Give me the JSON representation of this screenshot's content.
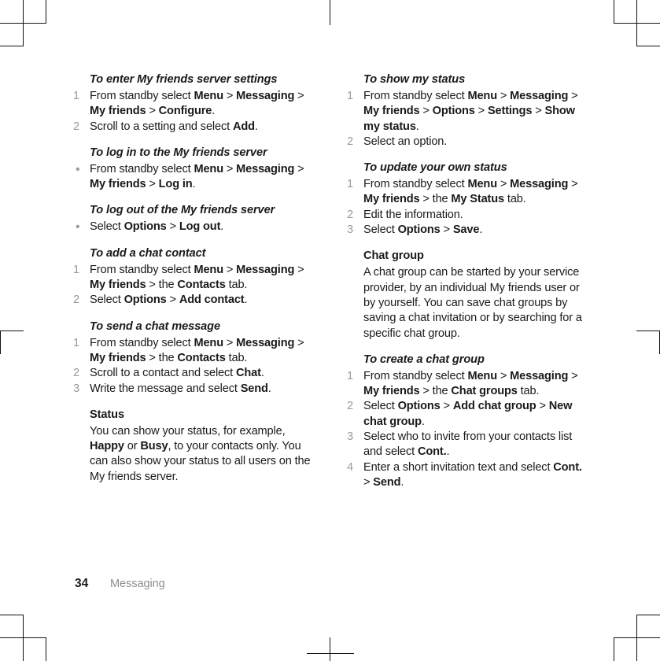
{
  "document": {
    "footer": {
      "page_number": "34",
      "running_head": "Messaging"
    }
  },
  "columns": {
    "left": {
      "blocks": [
        {
          "kind": "procedure",
          "title": "To enter My friends server settings",
          "list_type": "ordered",
          "steps": [
            {
              "marker": "1",
              "runs": [
                {
                  "t": "From standby select ",
                  "s": "n"
                },
                {
                  "t": "Menu",
                  "s": "b"
                },
                {
                  "t": " > ",
                  "s": "sep"
                },
                {
                  "t": "Messaging",
                  "s": "b"
                },
                {
                  "t": " > ",
                  "s": "sep"
                },
                {
                  "t": "My friends",
                  "s": "b"
                },
                {
                  "t": " > ",
                  "s": "sep"
                },
                {
                  "t": "Configure",
                  "s": "b"
                },
                {
                  "t": ".",
                  "s": "n"
                }
              ]
            },
            {
              "marker": "2",
              "runs": [
                {
                  "t": "Scroll to a setting and select ",
                  "s": "n"
                },
                {
                  "t": "Add",
                  "s": "b"
                },
                {
                  "t": ".",
                  "s": "n"
                }
              ]
            }
          ]
        },
        {
          "kind": "procedure",
          "title": "To log in to the My friends server",
          "list_type": "bullet",
          "steps": [
            {
              "marker": "•",
              "runs": [
                {
                  "t": "From standby select ",
                  "s": "n"
                },
                {
                  "t": "Menu",
                  "s": "b"
                },
                {
                  "t": " > ",
                  "s": "sep"
                },
                {
                  "t": "Messaging",
                  "s": "b"
                },
                {
                  "t": " > ",
                  "s": "sep"
                },
                {
                  "t": "My friends",
                  "s": "b"
                },
                {
                  "t": " > ",
                  "s": "sep"
                },
                {
                  "t": "Log in",
                  "s": "b"
                },
                {
                  "t": ".",
                  "s": "n"
                }
              ]
            }
          ]
        },
        {
          "kind": "procedure",
          "title": "To log out of the My friends server",
          "list_type": "bullet",
          "steps": [
            {
              "marker": "•",
              "runs": [
                {
                  "t": "Select ",
                  "s": "n"
                },
                {
                  "t": "Options",
                  "s": "b"
                },
                {
                  "t": " > ",
                  "s": "sep"
                },
                {
                  "t": "Log out",
                  "s": "b"
                },
                {
                  "t": ".",
                  "s": "n"
                }
              ]
            }
          ]
        },
        {
          "kind": "procedure",
          "title": "To add a chat contact",
          "list_type": "ordered",
          "steps": [
            {
              "marker": "1",
              "runs": [
                {
                  "t": "From standby select ",
                  "s": "n"
                },
                {
                  "t": "Menu",
                  "s": "b"
                },
                {
                  "t": " > ",
                  "s": "sep"
                },
                {
                  "t": "Messaging",
                  "s": "b"
                },
                {
                  "t": " > ",
                  "s": "sep"
                },
                {
                  "t": "My friends",
                  "s": "b"
                },
                {
                  "t": " > ",
                  "s": "sep"
                },
                {
                  "t": "the ",
                  "s": "n"
                },
                {
                  "t": "Contacts",
                  "s": "b"
                },
                {
                  "t": " tab.",
                  "s": "n"
                }
              ]
            },
            {
              "marker": "2",
              "runs": [
                {
                  "t": "Select ",
                  "s": "n"
                },
                {
                  "t": "Options",
                  "s": "b"
                },
                {
                  "t": " > ",
                  "s": "sep"
                },
                {
                  "t": "Add contact",
                  "s": "b"
                },
                {
                  "t": ".",
                  "s": "n"
                }
              ]
            }
          ]
        },
        {
          "kind": "procedure",
          "title": "To send a chat message",
          "list_type": "ordered",
          "steps": [
            {
              "marker": "1",
              "runs": [
                {
                  "t": "From standby select ",
                  "s": "n"
                },
                {
                  "t": "Menu",
                  "s": "b"
                },
                {
                  "t": " > ",
                  "s": "sep"
                },
                {
                  "t": "Messaging",
                  "s": "b"
                },
                {
                  "t": " > ",
                  "s": "sep"
                },
                {
                  "t": "My friends",
                  "s": "b"
                },
                {
                  "t": " > ",
                  "s": "sep"
                },
                {
                  "t": "the ",
                  "s": "n"
                },
                {
                  "t": "Contacts",
                  "s": "b"
                },
                {
                  "t": " tab.",
                  "s": "n"
                }
              ]
            },
            {
              "marker": "2",
              "runs": [
                {
                  "t": "Scroll to a contact and select ",
                  "s": "n"
                },
                {
                  "t": "Chat",
                  "s": "b"
                },
                {
                  "t": ".",
                  "s": "n"
                }
              ]
            },
            {
              "marker": "3",
              "runs": [
                {
                  "t": "Write the message and select ",
                  "s": "n"
                },
                {
                  "t": "Send",
                  "s": "b"
                },
                {
                  "t": ".",
                  "s": "n"
                }
              ]
            }
          ]
        },
        {
          "kind": "section",
          "title": "Status",
          "list_type": "paragraph",
          "paragraph_runs": [
            {
              "t": "You can show your status, for example, ",
              "s": "n"
            },
            {
              "t": "Happy",
              "s": "b"
            },
            {
              "t": " or ",
              "s": "n"
            },
            {
              "t": "Busy",
              "s": "b"
            },
            {
              "t": ", to your contacts only. You can also show your status to all users on the My friends server.",
              "s": "n"
            }
          ]
        }
      ]
    },
    "right": {
      "blocks": [
        {
          "kind": "procedure",
          "title": "To show my status",
          "list_type": "ordered",
          "steps": [
            {
              "marker": "1",
              "runs": [
                {
                  "t": "From standby select ",
                  "s": "n"
                },
                {
                  "t": "Menu",
                  "s": "b"
                },
                {
                  "t": " > ",
                  "s": "sep"
                },
                {
                  "t": "Messaging",
                  "s": "b"
                },
                {
                  "t": " > ",
                  "s": "sep"
                },
                {
                  "t": "My friends",
                  "s": "b"
                },
                {
                  "t": " > ",
                  "s": "sep"
                },
                {
                  "t": "Options",
                  "s": "b"
                },
                {
                  "t": " > ",
                  "s": "sep"
                },
                {
                  "t": "Settings",
                  "s": "b"
                },
                {
                  "t": " > ",
                  "s": "sep"
                },
                {
                  "t": "Show my status",
                  "s": "b"
                },
                {
                  "t": ".",
                  "s": "n"
                }
              ]
            },
            {
              "marker": "2",
              "runs": [
                {
                  "t": "Select an option.",
                  "s": "n"
                }
              ]
            }
          ]
        },
        {
          "kind": "procedure",
          "title": "To update your own status",
          "list_type": "ordered",
          "steps": [
            {
              "marker": "1",
              "runs": [
                {
                  "t": "From standby select ",
                  "s": "n"
                },
                {
                  "t": "Menu",
                  "s": "b"
                },
                {
                  "t": " > ",
                  "s": "sep"
                },
                {
                  "t": "Messaging",
                  "s": "b"
                },
                {
                  "t": " > ",
                  "s": "sep"
                },
                {
                  "t": "My friends",
                  "s": "b"
                },
                {
                  "t": " > ",
                  "s": "sep"
                },
                {
                  "t": "the ",
                  "s": "n"
                },
                {
                  "t": "My Status",
                  "s": "b"
                },
                {
                  "t": " tab.",
                  "s": "n"
                }
              ]
            },
            {
              "marker": "2",
              "runs": [
                {
                  "t": "Edit the information.",
                  "s": "n"
                }
              ]
            },
            {
              "marker": "3",
              "runs": [
                {
                  "t": "Select ",
                  "s": "n"
                },
                {
                  "t": "Options",
                  "s": "b"
                },
                {
                  "t": " > ",
                  "s": "sep"
                },
                {
                  "t": "Save",
                  "s": "b"
                },
                {
                  "t": ".",
                  "s": "n"
                }
              ]
            }
          ]
        },
        {
          "kind": "section",
          "title": "Chat group",
          "list_type": "paragraph",
          "paragraph_runs": [
            {
              "t": "A chat group can be started by your service provider, by an individual My friends user or by yourself. You can save chat groups by saving a chat invitation or by searching for a specific chat group.",
              "s": "n"
            }
          ]
        },
        {
          "kind": "procedure",
          "title": "To create a chat group",
          "list_type": "ordered",
          "steps": [
            {
              "marker": "1",
              "runs": [
                {
                  "t": "From standby select ",
                  "s": "n"
                },
                {
                  "t": "Menu",
                  "s": "b"
                },
                {
                  "t": " > ",
                  "s": "sep"
                },
                {
                  "t": "Messaging",
                  "s": "b"
                },
                {
                  "t": " > ",
                  "s": "sep"
                },
                {
                  "t": "My friends",
                  "s": "b"
                },
                {
                  "t": " > ",
                  "s": "sep"
                },
                {
                  "t": "the ",
                  "s": "n"
                },
                {
                  "t": "Chat groups",
                  "s": "b"
                },
                {
                  "t": " tab.",
                  "s": "n"
                }
              ]
            },
            {
              "marker": "2",
              "runs": [
                {
                  "t": "Select ",
                  "s": "n"
                },
                {
                  "t": "Options",
                  "s": "b"
                },
                {
                  "t": " > ",
                  "s": "sep"
                },
                {
                  "t": "Add chat group",
                  "s": "b"
                },
                {
                  "t": " > ",
                  "s": "sep"
                },
                {
                  "t": "New chat group",
                  "s": "b"
                },
                {
                  "t": ".",
                  "s": "n"
                }
              ]
            },
            {
              "marker": "3",
              "runs": [
                {
                  "t": "Select who to invite from your contacts list and select ",
                  "s": "n"
                },
                {
                  "t": "Cont.",
                  "s": "b"
                },
                {
                  "t": ".",
                  "s": "n"
                }
              ]
            },
            {
              "marker": "4",
              "runs": [
                {
                  "t": "Enter a short invitation text and select ",
                  "s": "n"
                },
                {
                  "t": "Cont.",
                  "s": "b"
                },
                {
                  "t": " > ",
                  "s": "sep"
                },
                {
                  "t": "Send",
                  "s": "b"
                },
                {
                  "t": ".",
                  "s": "n"
                }
              ]
            }
          ]
        }
      ]
    }
  },
  "crop_marks": {
    "color": "#111111"
  }
}
